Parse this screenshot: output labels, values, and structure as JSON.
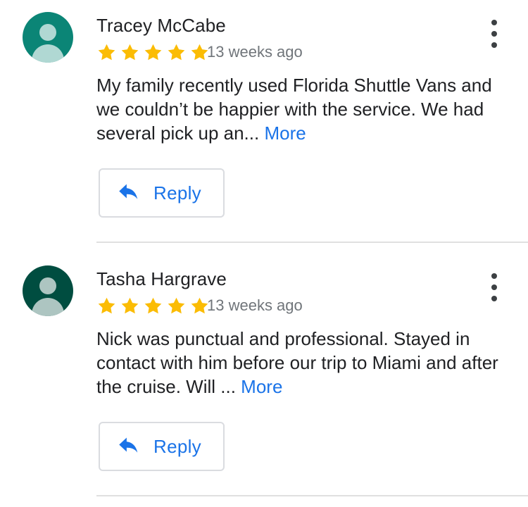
{
  "reviews": [
    {
      "avatar_color": "#0b8576",
      "avatar_icon": "person-icon",
      "author": "Tracey McCabe",
      "rating": 5,
      "max_rating": 5,
      "time": "13 weeks ago",
      "text": "My family recently used Florida Shuttle Vans and we couldn’t be happier with the service. We had several pick up an...",
      "more_label": "More",
      "reply_label": "Reply",
      "reply_icon": "reply-arrow-icon",
      "menu_icon": "more-vert-icon"
    },
    {
      "avatar_color": "#004d40",
      "avatar_icon": "person-icon",
      "author": "Tasha Hargrave",
      "rating": 5,
      "max_rating": 5,
      "time": "13 weeks ago",
      "text": "Nick was punctual and professional. Stayed in contact with him before our trip to Miami and after the cruise. Will ...",
      "more_label": "More",
      "reply_label": "Reply",
      "reply_icon": "reply-arrow-icon",
      "menu_icon": "more-vert-icon"
    }
  ],
  "colors": {
    "star": "#fbbc04",
    "link": "#1a73e8",
    "secondary_text": "#70757a",
    "divider": "#e0e0e0"
  }
}
